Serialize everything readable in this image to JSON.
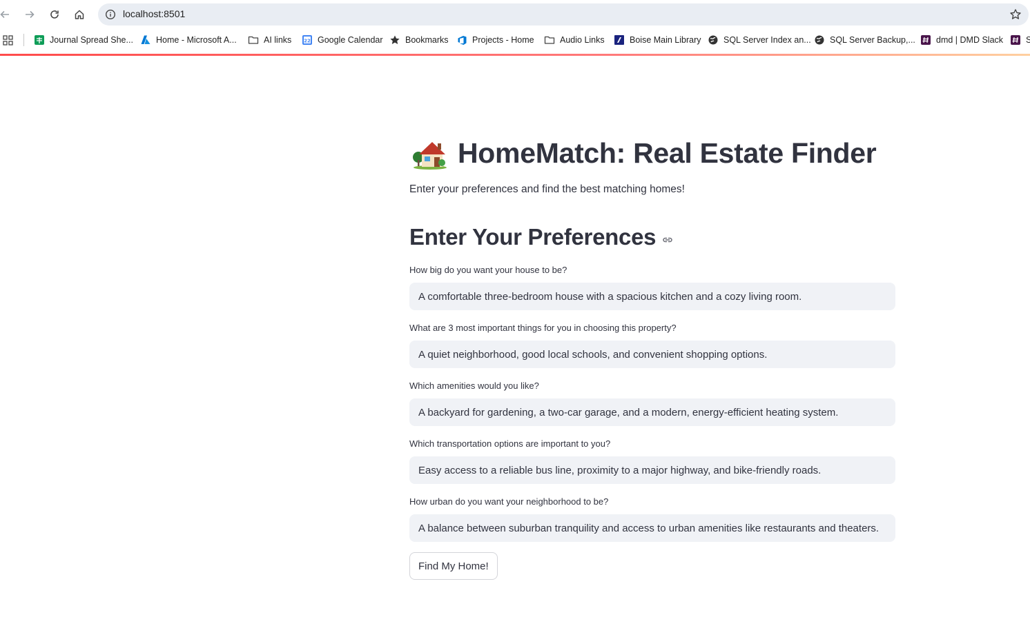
{
  "browser": {
    "url": "localhost:8501",
    "nav_icons": [
      "back-arrow-icon",
      "forward-arrow-icon",
      "reload-icon",
      "home-icon"
    ],
    "bookmarks": [
      {
        "label": "Journal Spread She...",
        "icon": "google-sheets-icon",
        "color": "#0f9d58"
      },
      {
        "label": "Home - Microsoft A...",
        "icon": "azure-icon",
        "color": "#0078d4"
      },
      {
        "label": "AI links",
        "icon": "folder-icon",
        "color": "#444746"
      },
      {
        "label": "Google Calendar",
        "icon": "google-calendar-icon",
        "color": "#4285f4"
      },
      {
        "label": "Bookmarks",
        "icon": "star-icon",
        "color": "#444746"
      },
      {
        "label": "Projects - Home",
        "icon": "azure-devops-icon",
        "color": "#0078d4"
      },
      {
        "label": "Audio Links",
        "icon": "folder-icon",
        "color": "#444746"
      },
      {
        "label": "Boise Main Library",
        "icon": "library-icon",
        "color": "#1a237e"
      },
      {
        "label": "SQL Server Index an...",
        "icon": "globe-icon",
        "color": "#444746"
      },
      {
        "label": "SQL Server Backup,...",
        "icon": "globe-icon",
        "color": "#444746"
      },
      {
        "label": "dmd | DMD Slack",
        "icon": "slack-icon",
        "color": "#4a154b"
      },
      {
        "label": "S",
        "icon": "slack-icon",
        "color": "#4a154b"
      }
    ]
  },
  "app": {
    "accent_color": "#ff4b4b",
    "title": "HomeMatch: Real Estate Finder",
    "title_icon": "house-emoji-icon",
    "subtitle": "Enter your preferences and find the best matching homes!",
    "section_heading": "Enter Your Preferences",
    "fields": [
      {
        "label": "How big do you want your house to be?",
        "value": "A comfortable three-bedroom house with a spacious kitchen and a cozy living room."
      },
      {
        "label": "What are 3 most important things for you in choosing this property?",
        "value": "A quiet neighborhood, good local schools, and convenient shopping options."
      },
      {
        "label": "Which amenities would you like?",
        "value": "A backyard for gardening, a two-car garage, and a modern, energy-efficient heating system."
      },
      {
        "label": "Which transportation options are important to you?",
        "value": "Easy access to a reliable bus line, proximity to a major highway, and bike-friendly roads."
      },
      {
        "label": "How urban do you want your neighborhood to be?",
        "value": "A balance between suburban tranquility and access to urban amenities like restaurants and theaters."
      }
    ],
    "submit_label": "Find My Home!"
  }
}
